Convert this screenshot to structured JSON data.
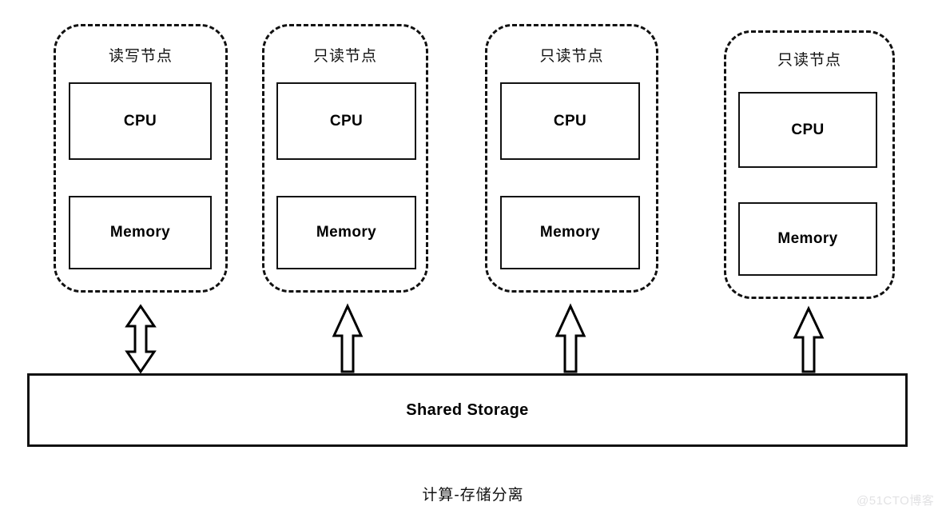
{
  "diagram": {
    "caption": "计算-存储分离",
    "watermark": "@51CTO博客",
    "nodes": [
      {
        "title": "读写节点",
        "cpu_label": "CPU",
        "memory_label": "Memory",
        "arrow_kind": "double-arrow-vertical"
      },
      {
        "title": "只读节点",
        "cpu_label": "CPU",
        "memory_label": "Memory",
        "arrow_kind": "up-arrow"
      },
      {
        "title": "只读节点",
        "cpu_label": "CPU",
        "memory_label": "Memory",
        "arrow_kind": "up-arrow"
      },
      {
        "title": "只读节点",
        "cpu_label": "CPU",
        "memory_label": "Memory",
        "arrow_kind": "up-arrow"
      }
    ],
    "storage": {
      "label": "Shared Storage"
    },
    "colors": {
      "stroke": "#111111",
      "fill": "#ffffff",
      "watermark": "#e2e2e4"
    }
  }
}
